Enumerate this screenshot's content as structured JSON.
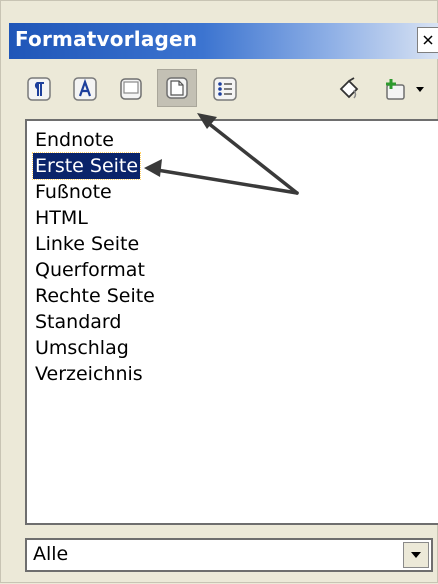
{
  "panel": {
    "title": "Formatvorlagen"
  },
  "toolbar": {
    "buttons": [
      {
        "icon": "paragraph-styles-icon"
      },
      {
        "icon": "character-styles-icon"
      },
      {
        "icon": "frame-styles-icon"
      },
      {
        "icon": "page-styles-icon",
        "active": true
      },
      {
        "icon": "list-styles-icon"
      },
      {
        "icon": "fill-format-mode-icon"
      },
      {
        "icon": "new-style-from-selection-icon"
      },
      {
        "icon": "dropdown-arrow-icon"
      }
    ]
  },
  "styles_list": {
    "items": [
      "Endnote",
      "Erste Seite",
      "Fußnote",
      "HTML",
      "Linke Seite",
      "Querformat",
      "Rechte Seite",
      "Standard",
      "Umschlag",
      "Verzeichnis"
    ],
    "selected": "Erste Seite"
  },
  "filter": {
    "value": "Alle"
  },
  "colors": {
    "title_gradient_start": "#1f56b8",
    "selection_bg": "#0a246a",
    "panel_bg": "#ece9d8"
  }
}
